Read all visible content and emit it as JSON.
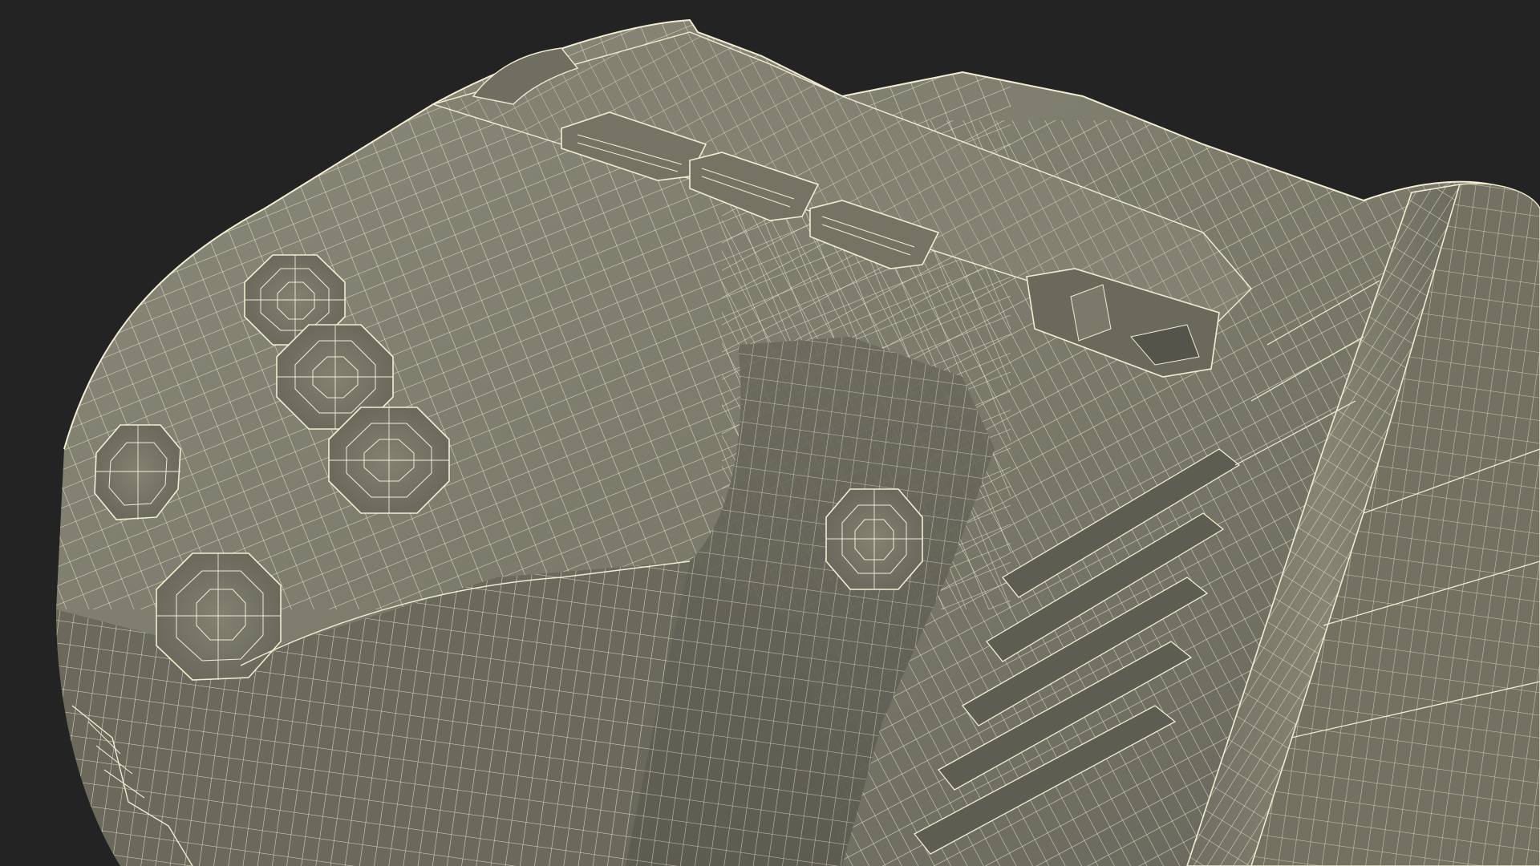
{
  "scene": {
    "background_color": "#232323",
    "surface_color": "#7d7c6c",
    "surface_shadow_color": "#5f5e52",
    "surface_highlight_color": "#8e8d7c",
    "wire_color": "#f1ecd2",
    "render_style": "wireframe-on-shaded",
    "object": "3d-model-controller-housing"
  }
}
